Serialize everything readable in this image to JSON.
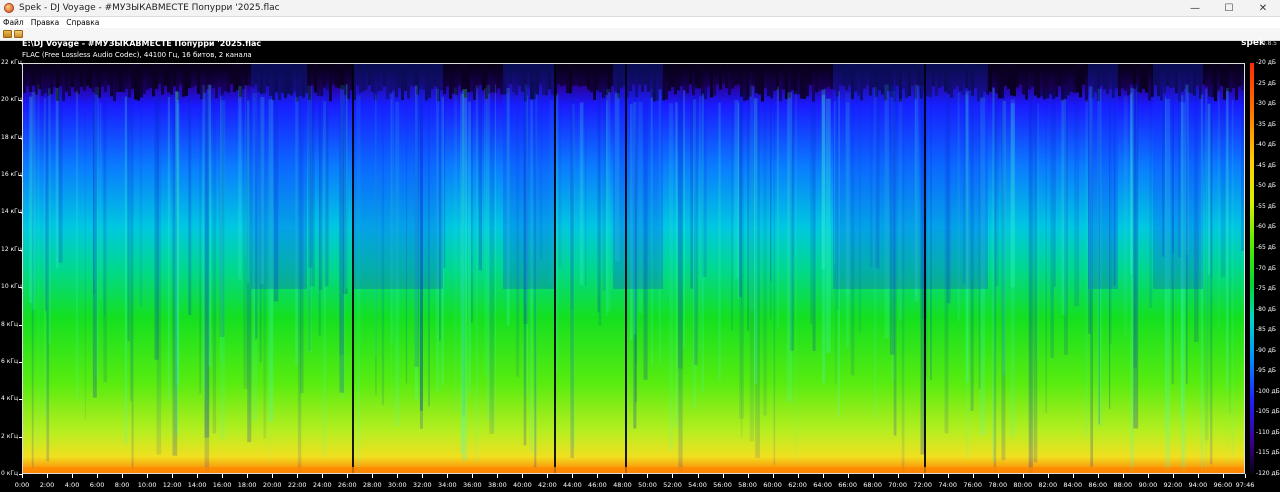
{
  "window": {
    "title": "Spek - DJ Voyage - #МУЗЫКАВМЕСТЕ Попурри '2025.flac",
    "minimize": "—",
    "maximize": "☐",
    "close": "✕"
  },
  "menu": {
    "items": [
      {
        "label": "Файл"
      },
      {
        "label": "Правка"
      },
      {
        "label": "Справка"
      }
    ]
  },
  "toolbar": {
    "icons": [
      "open-file-icon",
      "preferences-icon"
    ]
  },
  "header": {
    "file_path": "E:\\DJ Voyage - #МУЗЫКАВМЕСТЕ Попурри '2025.flac",
    "stream_info": "FLAC (Free Lossless Audio Codec), 44100 Гц, 16 битов, 2 канала",
    "logo": "spek",
    "version": "0.8.5"
  },
  "freq_axis": {
    "labels": [
      "22 кГц",
      "20 кГц",
      "18 кГц",
      "16 кГц",
      "14 кГц",
      "12 кГц",
      "10 кГц",
      "8 кГц",
      "6 кГц",
      "4 кГц",
      "2 кГц",
      "0 кГц"
    ]
  },
  "time_axis": {
    "labels": [
      "0:00",
      "2:00",
      "4:00",
      "6:00",
      "8:00",
      "10:00",
      "12:00",
      "14:00",
      "16:00",
      "18:00",
      "20:00",
      "22:00",
      "24:00",
      "26:00",
      "28:00",
      "30:00",
      "32:00",
      "34:00",
      "36:00",
      "38:00",
      "40:00",
      "42:00",
      "44:00",
      "46:00",
      "48:00",
      "50:00",
      "52:00",
      "54:00",
      "56:00",
      "58:00",
      "60:00",
      "62:00",
      "64:00",
      "66:00",
      "68:00",
      "70:00",
      "72:00",
      "74:00",
      "76:00",
      "78:00",
      "80:00",
      "82:00",
      "84:00",
      "86:00",
      "88:00",
      "90:00",
      "92:00",
      "94:00",
      "96:00",
      "97:46"
    ]
  },
  "db_scale": {
    "labels": [
      "-20 дБ",
      "-25 дБ",
      "-30 дБ",
      "-35 дБ",
      "-40 дБ",
      "-45 дБ",
      "-50 дБ",
      "-55 дБ",
      "-60 дБ",
      "-65 дБ",
      "-70 дБ",
      "-75 дБ",
      "-80 дБ",
      "-85 дБ",
      "-90 дБ",
      "-95 дБ",
      "-100 дБ",
      "-105 дБ",
      "-110 дБ",
      "-115 дБ",
      "-120 дБ"
    ]
  },
  "colors": {
    "background": "#000000",
    "high": "#ff2a00",
    "mid": "#55ee00",
    "low": "#2020ff"
  }
}
